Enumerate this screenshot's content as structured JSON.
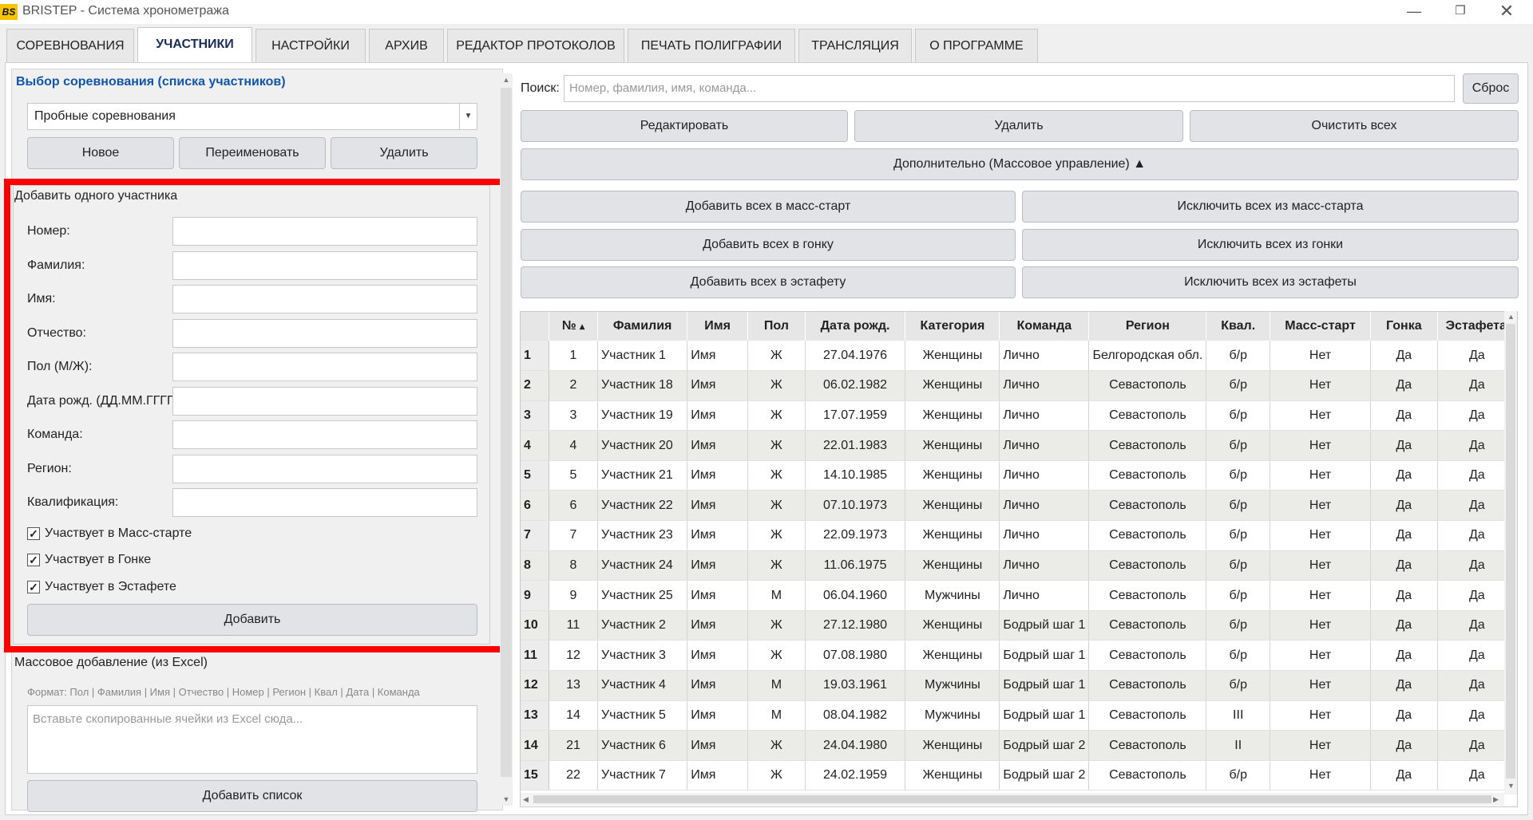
{
  "window": {
    "title": "BRISTEP - Система хронометража",
    "logo_text": "BS"
  },
  "tabs": [
    {
      "label": "СОРЕВНОВАНИЯ"
    },
    {
      "label": "УЧАСТНИКИ"
    },
    {
      "label": "НАСТРОЙКИ"
    },
    {
      "label": "АРХИВ"
    },
    {
      "label": "РЕДАКТОР ПРОТОКОЛОВ"
    },
    {
      "label": "ПЕЧАТЬ ПОЛИГРАФИИ"
    },
    {
      "label": "ТРАНСЛЯЦИЯ"
    },
    {
      "label": "О ПРОГРАММЕ"
    }
  ],
  "active_tab": "УЧАСТНИКИ",
  "left": {
    "section_title": "Выбор соревнования (списка участников)",
    "competition_selected": "Пробные соревнования",
    "buttons": {
      "new": "Новое",
      "rename": "Переименовать",
      "delete": "Удалить"
    },
    "add_one": {
      "title": "Добавить одного участника",
      "fields": [
        {
          "label": "Номер:",
          "value": ""
        },
        {
          "label": "Фамилия:",
          "value": ""
        },
        {
          "label": "Имя:",
          "value": ""
        },
        {
          "label": "Отчество:",
          "value": ""
        },
        {
          "label": "Пол (М/Ж):",
          "value": ""
        },
        {
          "label": "Дата рожд. (ДД.ММ.ГГГГ):",
          "value": ""
        },
        {
          "label": "Команда:",
          "value": ""
        },
        {
          "label": "Регион:",
          "value": ""
        },
        {
          "label": "Квалификация:",
          "value": ""
        }
      ],
      "checkboxes": [
        {
          "label": "Участвует в Масс-старте",
          "checked": true
        },
        {
          "label": "Участвует в Гонке",
          "checked": true
        },
        {
          "label": "Участвует в Эстафете",
          "checked": true
        }
      ],
      "check_mark": "✓",
      "add_button": "Добавить"
    },
    "mass_add": {
      "title": "Массовое добавление (из Excel)",
      "format_hint": "Формат: Пол | Фамилия | Имя | Отчество | Номер | Регион | Квал | Дата | Команда",
      "placeholder": "Вставьте скопированные ячейки из Excel сюда...",
      "add_list_button": "Добавить список"
    }
  },
  "right": {
    "search_label": "Поиск:",
    "search_placeholder": "Номер, фамилия, имя, команда...",
    "reset_button": "Сброс",
    "edit_button": "Редактировать",
    "delete_button": "Удалить",
    "clear_all_button": "Очистить всех",
    "extra_button": "Дополнительно (Массовое управление) ▲",
    "mass": {
      "add_mass": "Добавить всех в масс-старт",
      "exclude_mass": "Исключить всех из масс-старта",
      "add_race": "Добавить всех в гонку",
      "exclude_race": "Исключить всех из гонки",
      "add_relay": "Добавить всех в эстафету",
      "exclude_relay": "Исключить всех из эстафеты"
    },
    "table": {
      "sort_indicator": "▴",
      "headers": [
        "№",
        "Фамилия",
        "Имя",
        "Пол",
        "Дата рожд.",
        "Категория",
        "Команда",
        "Регион",
        "Квал.",
        "Масс-старт",
        "Гонка",
        "Эстафета"
      ],
      "rows": [
        [
          "1",
          "1",
          "Участник 1",
          "Имя",
          "Ж",
          "27.04.1976",
          "Женщины",
          "Лично",
          "Белгородская обл.",
          "б/р",
          "Нет",
          "Да",
          "Да"
        ],
        [
          "2",
          "2",
          "Участник 18",
          "Имя",
          "Ж",
          "06.02.1982",
          "Женщины",
          "Лично",
          "Севастополь",
          "б/р",
          "Нет",
          "Да",
          "Да"
        ],
        [
          "3",
          "3",
          "Участник 19",
          "Имя",
          "Ж",
          "17.07.1959",
          "Женщины",
          "Лично",
          "Севастополь",
          "б/р",
          "Нет",
          "Да",
          "Да"
        ],
        [
          "4",
          "4",
          "Участник 20",
          "Имя",
          "Ж",
          "22.01.1983",
          "Женщины",
          "Лично",
          "Севастополь",
          "б/р",
          "Нет",
          "Да",
          "Да"
        ],
        [
          "5",
          "5",
          "Участник 21",
          "Имя",
          "Ж",
          "14.10.1985",
          "Женщины",
          "Лично",
          "Севастополь",
          "б/р",
          "Нет",
          "Да",
          "Да"
        ],
        [
          "6",
          "6",
          "Участник 22",
          "Имя",
          "Ж",
          "07.10.1973",
          "Женщины",
          "Лично",
          "Севастополь",
          "б/р",
          "Нет",
          "Да",
          "Да"
        ],
        [
          "7",
          "7",
          "Участник 23",
          "Имя",
          "Ж",
          "22.09.1973",
          "Женщины",
          "Лично",
          "Севастополь",
          "б/р",
          "Нет",
          "Да",
          "Да"
        ],
        [
          "8",
          "8",
          "Участник 24",
          "Имя",
          "Ж",
          "11.06.1975",
          "Женщины",
          "Лично",
          "Севастополь",
          "б/р",
          "Нет",
          "Да",
          "Да"
        ],
        [
          "9",
          "9",
          "Участник 25",
          "Имя",
          "М",
          "06.04.1960",
          "Мужчины",
          "Лично",
          "Севастополь",
          "б/р",
          "Нет",
          "Да",
          "Да"
        ],
        [
          "10",
          "11",
          "Участник 2",
          "Имя",
          "Ж",
          "27.12.1980",
          "Женщины",
          "Бодрый шаг 1",
          "Севастополь",
          "б/р",
          "Нет",
          "Да",
          "Да"
        ],
        [
          "11",
          "12",
          "Участник 3",
          "Имя",
          "Ж",
          "07.08.1980",
          "Женщины",
          "Бодрый шаг 1",
          "Севастополь",
          "б/р",
          "Нет",
          "Да",
          "Да"
        ],
        [
          "12",
          "13",
          "Участник 4",
          "Имя",
          "М",
          "19.03.1961",
          "Мужчины",
          "Бодрый шаг 1",
          "Севастополь",
          "б/р",
          "Нет",
          "Да",
          "Да"
        ],
        [
          "13",
          "14",
          "Участник 5",
          "Имя",
          "М",
          "08.04.1982",
          "Мужчины",
          "Бодрый шаг 1",
          "Севастополь",
          "III",
          "Нет",
          "Да",
          "Да"
        ],
        [
          "14",
          "21",
          "Участник 6",
          "Имя",
          "Ж",
          "24.04.1980",
          "Женщины",
          "Бодрый шаг 2",
          "Севастополь",
          "II",
          "Нет",
          "Да",
          "Да"
        ],
        [
          "15",
          "22",
          "Участник 7",
          "Имя",
          "Ж",
          "24.02.1959",
          "Женщины",
          "Бодрый шаг 2",
          "Севастополь",
          "б/р",
          "Нет",
          "Да",
          "Да"
        ]
      ]
    }
  },
  "colors": {
    "highlight": "#ff0000",
    "accent": "#1155aa",
    "logo": "#f6c400"
  }
}
